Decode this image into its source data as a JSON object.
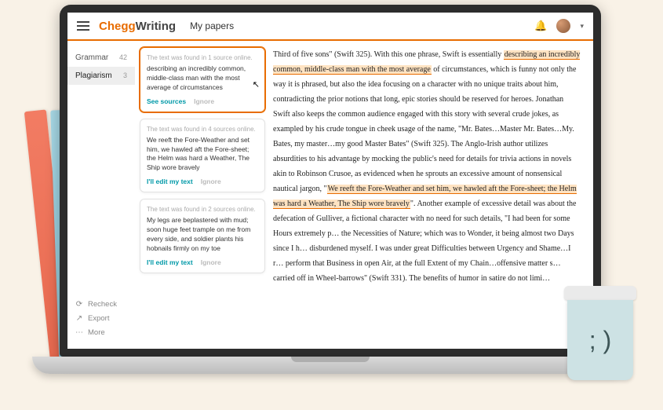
{
  "header": {
    "brand1": "Chegg",
    "brand2": "Writing",
    "nav": "My papers"
  },
  "sidebar": {
    "items": [
      {
        "label": "Grammar",
        "count": "42"
      },
      {
        "label": "Plagiarism",
        "count": "3"
      }
    ],
    "footer": {
      "recheck": "Recheck",
      "export": "Export",
      "more": "More"
    }
  },
  "cards": [
    {
      "source": "The text was found in 1 source online.",
      "text": "describing an incredibly common, middle-class man with the most average of circumstances",
      "action1": "See sources",
      "action2": "Ignore"
    },
    {
      "source": "The text was found in 4 sources online.",
      "text": "We reeft the Fore-Weather and  set him, we hawled aft the Fore-sheet; the Helm was hard a Weather, The Ship wore bravely",
      "action1": "I'll edit my text",
      "action2": "Ignore"
    },
    {
      "source": "The text was found in 2 sources online.",
      "text": "My legs are beplastered with mud; soon huge feet trample on me from every side, and soldier plants his hobnails firmly on my toe",
      "action1": "I'll edit my text",
      "action2": "Ignore"
    }
  ],
  "doc": {
    "p1a": "Third of five sons\" (Swift 325). With this one phrase, Swift is essentially ",
    "hl1": "describing an incredibly common, middle-class man with the most average",
    "p1b": " of circumstances, which is funny not only the way it is phrased, but also the idea focusing on a character with no unique traits about him, contradicting the prior notions that long, epic stories should be reserved for heroes. Jonathan Swift also keeps the common audience engaged with this story with several crude jokes, as exampled by his crude tongue in cheek usage of the name, \"Mr. Bates…Master Mr. Bates…My. Bates, my master…my good Master Bates\" (Swift 325). The Anglo-Irish author utilizes absurdities to his advantage by mocking the public's need for details for trivia actions in novels akin to Robinson Crusoe, as evidenced when he sprouts an excessive amount of nonsensical nautical jargon, \"",
    "hl2": "We reeft the Fore-Weather and  set him, we hawled aft the Fore-sheet; the Helm was hard a Weather, The Ship wore bravely",
    "p1c": "\". Another example of excessive detail was about the defecation of Gulliver, a fictional character with no need for such details, \"I had been for some Hours extremely p… the Necessities of Nature; which was to Wonder, it being almost two Days since I h… disburdened myself. I was under great Difficulties between Urgency and Shame…I r… perform that Business in open Air, at the full Extent of my Chain…offensive matter s… carried off in Wheel-barrows\" (Swift 331). The benefits of humor in satire do not limi…"
  },
  "cup_face": "; )"
}
